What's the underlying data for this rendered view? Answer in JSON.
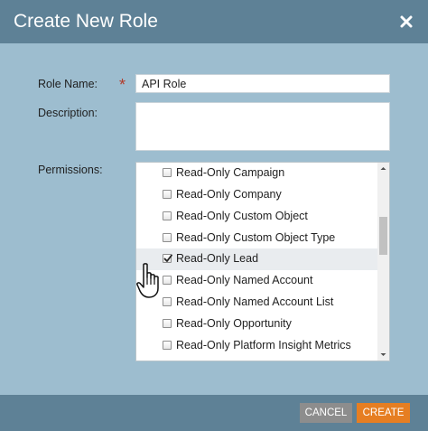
{
  "dialog": {
    "title": "Create New Role",
    "close_icon": "close-x-icon"
  },
  "form": {
    "role_name_label": "Role Name:",
    "required_marker": "*",
    "role_name_value": "API Role",
    "description_label": "Description:",
    "description_value": "",
    "permissions_label": "Permissions:"
  },
  "permissions": [
    {
      "label": "Read-Only Campaign",
      "checked": false
    },
    {
      "label": "Read-Only Company",
      "checked": false
    },
    {
      "label": "Read-Only Custom Object",
      "checked": false
    },
    {
      "label": "Read-Only Custom Object Type",
      "checked": false
    },
    {
      "label": "Read-Only Lead",
      "checked": true
    },
    {
      "label": "Read-Only Named Account",
      "checked": false
    },
    {
      "label": "Read-Only Named Account List",
      "checked": false
    },
    {
      "label": "Read-Only Opportunity",
      "checked": false
    },
    {
      "label": "Read-Only Platform Insight Metrics",
      "checked": false
    }
  ],
  "footer": {
    "cancel_label": "CANCEL",
    "create_label": "CREATE"
  },
  "colors": {
    "header_bg": "#5e8196",
    "body_bg": "#9dbdcf",
    "create_button": "#e67e22",
    "cancel_button": "#8d8d8d",
    "required_star": "#b23b2a"
  }
}
